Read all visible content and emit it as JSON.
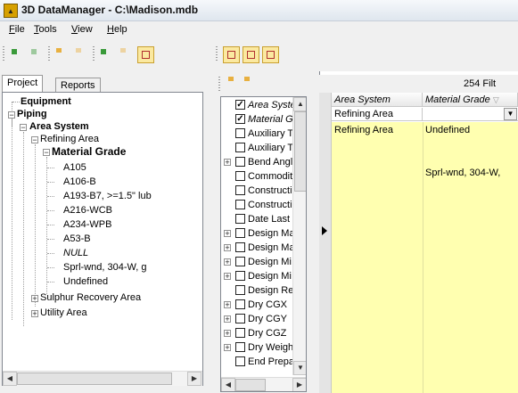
{
  "window": {
    "title": "3D DataManager - C:\\Madison.mdb",
    "icon": "app-logo-icon"
  },
  "menu": {
    "items": [
      {
        "label": "File",
        "accel": "F",
        "rest": "ile"
      },
      {
        "label": "Tools",
        "accel": "T",
        "rest": "ools"
      },
      {
        "label": "View",
        "accel": "V",
        "rest": "iew"
      },
      {
        "label": "Help",
        "accel": "H",
        "rest": "elp"
      }
    ]
  },
  "tabs": {
    "project": "Project",
    "reports": "Reports"
  },
  "tree": {
    "equipment": "Equipment",
    "piping": "Piping",
    "area_system": "Area System",
    "refining_area": "Refining Area",
    "material_grade": "Material Grade",
    "grades": [
      "A105",
      "A106-B",
      "A193-B7, >=1.5\" lub",
      "A216-WCB",
      "A234-WPB",
      "A53-B",
      "NULL",
      "Sprl-wnd, 304-W, g",
      "Undefined"
    ],
    "sulphur": "Sulphur Recovery Area",
    "utility": "Utility Area"
  },
  "fields": [
    {
      "label": "Area Syste",
      "checked": true,
      "italic": true,
      "expandable": false
    },
    {
      "label": "Material G",
      "checked": true,
      "italic": true,
      "expandable": false
    },
    {
      "label": "Auxiliary T",
      "checked": false,
      "italic": false,
      "expandable": false
    },
    {
      "label": "Auxiliary T",
      "checked": false,
      "italic": false,
      "expandable": false
    },
    {
      "label": "Bend Angl",
      "checked": false,
      "italic": false,
      "expandable": true
    },
    {
      "label": "Commodity",
      "checked": false,
      "italic": false,
      "expandable": false
    },
    {
      "label": "Constructio",
      "checked": false,
      "italic": false,
      "expandable": false
    },
    {
      "label": "Constructio",
      "checked": false,
      "italic": false,
      "expandable": false
    },
    {
      "label": "Date Last",
      "checked": false,
      "italic": false,
      "expandable": false
    },
    {
      "label": "Design Ma",
      "checked": false,
      "italic": false,
      "expandable": true
    },
    {
      "label": "Design Ma",
      "checked": false,
      "italic": false,
      "expandable": true
    },
    {
      "label": "Design Mi",
      "checked": false,
      "italic": false,
      "expandable": true
    },
    {
      "label": "Design Mi",
      "checked": false,
      "italic": false,
      "expandable": true
    },
    {
      "label": "Design Re",
      "checked": false,
      "italic": false,
      "expandable": false
    },
    {
      "label": "Dry CGX",
      "checked": false,
      "italic": false,
      "expandable": true
    },
    {
      "label": "Dry CGY",
      "checked": false,
      "italic": false,
      "expandable": true
    },
    {
      "label": "Dry CGZ",
      "checked": false,
      "italic": false,
      "expandable": true
    },
    {
      "label": "Dry Weigh",
      "checked": false,
      "italic": false,
      "expandable": true
    },
    {
      "label": "End Prepa",
      "checked": false,
      "italic": false,
      "expandable": false
    }
  ],
  "grid": {
    "count_label": "254 Filt",
    "headers": [
      "Area System",
      "Material Grade"
    ],
    "filter_value": "Refining Area",
    "rows": [
      {
        "area": "Refining Area",
        "grade": "Undefined"
      },
      {
        "area": "",
        "grade": "Sprl-wnd, 304-W,"
      }
    ]
  }
}
